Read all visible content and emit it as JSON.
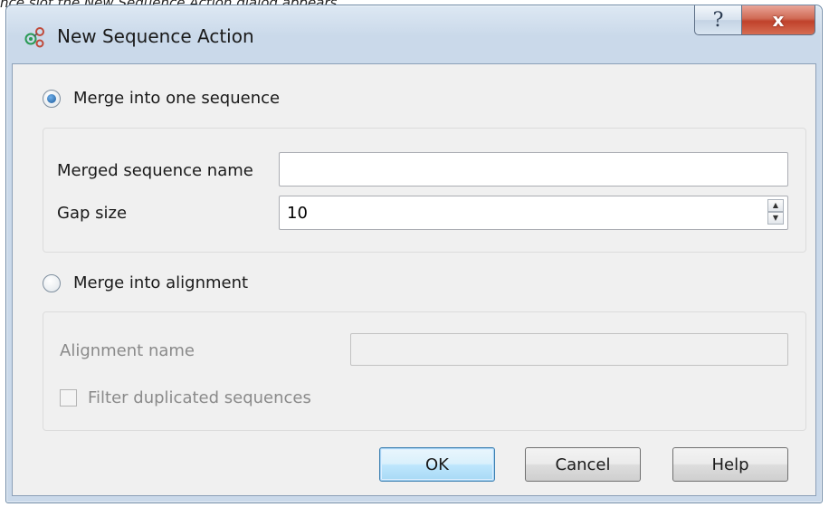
{
  "caption": {
    "prefix": "nce",
    "middle": " slot the ",
    "emph": "New Sequence Action",
    "suffix": " dialog appears."
  },
  "window": {
    "title": "New Sequence Action",
    "title_icon": "sequence-action-icon",
    "help_glyph": "?",
    "close_glyph": "x"
  },
  "merge_sequence": {
    "label": "Merge into one sequence",
    "selected": true,
    "name_label": "Merged sequence name",
    "name_value": "",
    "gap_label": "Gap size",
    "gap_value": "10"
  },
  "merge_alignment": {
    "label": "Merge into alignment",
    "selected": false,
    "name_label": "Alignment name",
    "name_value": "",
    "filter_label": "Filter duplicated sequences",
    "filter_checked": false
  },
  "buttons": {
    "ok": "OK",
    "cancel": "Cancel",
    "help": "Help"
  },
  "colors": {
    "accent": "#3c7fb1",
    "close": "#c0412b",
    "frame": "#cad9ea",
    "disabled_text": "#8a8a8a"
  }
}
